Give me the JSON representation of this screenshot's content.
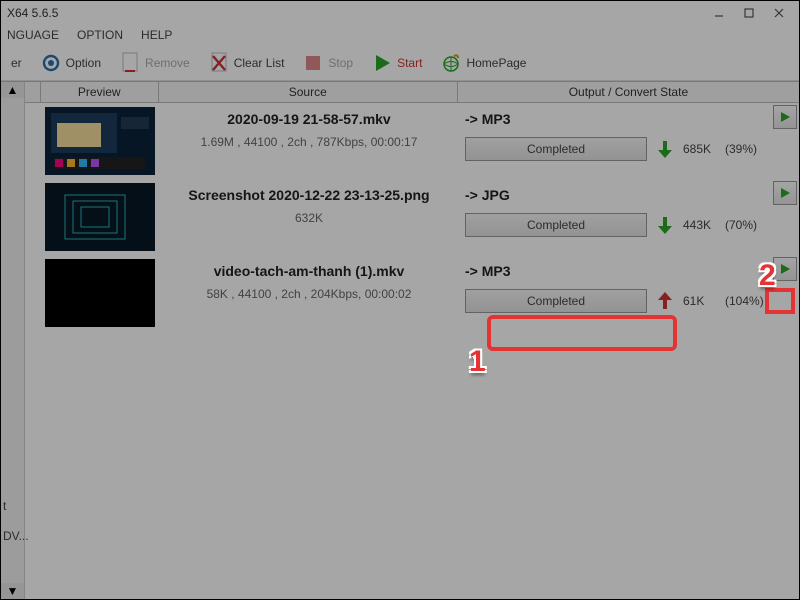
{
  "window": {
    "title": "X64 5.6.5"
  },
  "menu": {
    "items": [
      "NGUAGE",
      "OPTION",
      "HELP"
    ]
  },
  "toolbar": {
    "er": "er",
    "option": "Option",
    "remove": "Remove",
    "clear_list": "Clear List",
    "stop": "Stop",
    "start": "Start",
    "homepage": "HomePage"
  },
  "columns": {
    "preview": "Preview",
    "source": "Source",
    "output": "Output / Convert State"
  },
  "rows": [
    {
      "name": "2020-09-19 21-58-57.mkv",
      "info": "1.69M , 44100 , 2ch , 787Kbps, 00:00:17",
      "size_only": "",
      "format": "-> MP3",
      "status": "Completed",
      "out_size": "685K",
      "out_pct": "(39%)",
      "arrow": "down"
    },
    {
      "name": "Screenshot 2020-12-22 23-13-25.png",
      "info": "",
      "size_only": "632K",
      "format": "-> JPG",
      "status": "Completed",
      "out_size": "443K",
      "out_pct": "(70%)",
      "arrow": "down"
    },
    {
      "name": "video-tach-am-thanh (1).mkv",
      "info": "58K , 44100 , 2ch , 204Kbps, 00:00:02",
      "size_only": "",
      "format": "-> MP3",
      "status": "Completed",
      "out_size": "61K",
      "out_pct": "(104%)",
      "arrow": "up"
    }
  ],
  "left_labels": {
    "t": "t",
    "dv": "DV..."
  },
  "annotations": {
    "n1": "1",
    "n2": "2"
  }
}
